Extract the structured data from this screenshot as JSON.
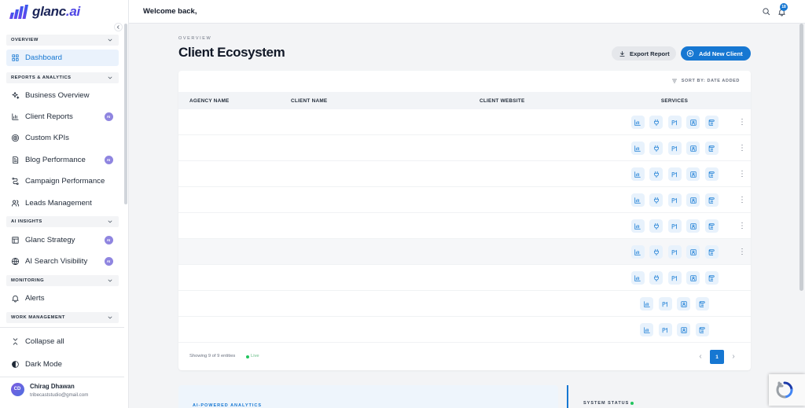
{
  "logo": {
    "name": "glanc",
    "suffix": ".ai"
  },
  "header": {
    "welcome": "Welcome back,",
    "notification_count": "18"
  },
  "sidebar": {
    "sections": [
      {
        "title": "OVERVIEW",
        "items": [
          {
            "label": "Dashboard",
            "icon": "grid-icon",
            "active": true
          }
        ]
      },
      {
        "title": "REPORTS & ANALYTICS",
        "items": [
          {
            "label": "Business Overview",
            "icon": "sparkles-icon"
          },
          {
            "label": "Client Reports",
            "icon": "bar-chart-icon",
            "badge": "AI"
          },
          {
            "label": "Custom KPIs",
            "icon": "target-icon"
          },
          {
            "label": "Blog Performance",
            "icon": "document-icon",
            "badge": "AI"
          },
          {
            "label": "Campaign Performance",
            "icon": "route-icon"
          },
          {
            "label": "Leads Management",
            "icon": "users-icon"
          }
        ]
      },
      {
        "title": "AI INSIGHTS",
        "items": [
          {
            "label": "Glanc Strategy",
            "icon": "layout-icon",
            "badge": "AI"
          },
          {
            "label": "AI Search Visibility",
            "icon": "globe-icon",
            "badge": "AI"
          }
        ]
      },
      {
        "title": "MONITORING",
        "items": [
          {
            "label": "Alerts",
            "icon": "bell-icon"
          }
        ]
      },
      {
        "title": "WORK MANAGEMENT",
        "items": []
      }
    ],
    "collapse_all": "Collapse all",
    "dark_mode": "Dark Mode",
    "user": {
      "initials": "CD",
      "name": "Chirag Dhawan",
      "email": "tribecaststudio@gmail.com"
    }
  },
  "page": {
    "eyebrow": "OVERVIEW",
    "title": "Client Ecosystem",
    "export_label": "Export Report",
    "add_label": "Add New Client"
  },
  "table": {
    "sort_label": "SORT BY: DATE ADDED",
    "columns": {
      "agency": "AGENCY NAME",
      "client": "CLIENT NAME",
      "website": "CLIENT WEBSITE",
      "services": "SERVICES"
    },
    "rows": [
      {
        "services": [
          "bar-chart-icon",
          "plug-icon",
          "ranking-icon",
          "profile-card-icon",
          "scroll-icon"
        ],
        "has_menu": true
      },
      {
        "services": [
          "bar-chart-icon",
          "plug-icon",
          "ranking-icon",
          "profile-card-icon",
          "scroll-icon"
        ],
        "has_menu": true
      },
      {
        "services": [
          "bar-chart-icon",
          "plug-icon",
          "ranking-icon",
          "profile-card-icon",
          "scroll-icon"
        ],
        "has_menu": true
      },
      {
        "services": [
          "bar-chart-icon",
          "plug-icon",
          "ranking-icon",
          "profile-card-icon",
          "scroll-icon"
        ],
        "has_menu": true
      },
      {
        "services": [
          "bar-chart-icon",
          "plug-icon",
          "ranking-icon",
          "profile-card-icon",
          "scroll-icon"
        ],
        "has_menu": true
      },
      {
        "services": [
          "bar-chart-icon",
          "plug-icon",
          "ranking-icon",
          "profile-card-icon",
          "scroll-icon"
        ],
        "has_menu": true,
        "highlighted": true
      },
      {
        "services": [
          "bar-chart-icon",
          "plug-icon",
          "ranking-icon",
          "profile-card-icon",
          "scroll-icon"
        ],
        "has_menu": false
      },
      {
        "services": [
          "bar-chart-icon",
          "ranking-icon",
          "profile-card-icon",
          "scroll-icon"
        ],
        "has_menu": false
      },
      {
        "services": [
          "bar-chart-icon",
          "ranking-icon",
          "profile-card-icon",
          "scroll-icon"
        ],
        "has_menu": false
      }
    ],
    "footer": {
      "showing": "Showing 9 of 9 entities",
      "live": "Live"
    },
    "pagination": {
      "current_page": "1"
    }
  },
  "lower": {
    "analytics_label": "AI-POWERED ANALYTICS",
    "system_status_label": "SYSTEM STATUS"
  },
  "colors": {
    "accent": "#1677d2",
    "ai_badge": "#8f85e0",
    "live": "#22c55e",
    "service_icon_bg": "#e8f2fc"
  }
}
